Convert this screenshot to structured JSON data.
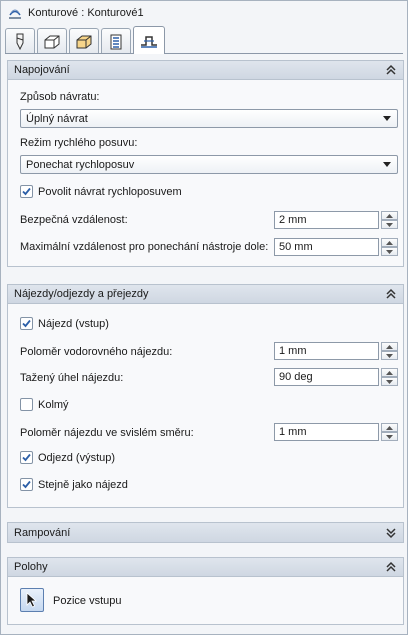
{
  "title": "Konturové : Konturové1",
  "tabs": [
    {
      "icon": "tool-icon"
    },
    {
      "icon": "cube-icon"
    },
    {
      "icon": "stock-icon"
    },
    {
      "icon": "passes-icon"
    },
    {
      "icon": "linking-icon"
    }
  ],
  "linking": {
    "header": "Napojování",
    "retract_label": "Způsob návratu:",
    "retract_value": "Úplný návrat",
    "rapid_label": "Režim rychlého posuvu:",
    "rapid_value": "Ponechat rychloposuv",
    "allow_rapid_label": "Povolit návrat rychloposuvem",
    "allow_rapid_checked": true,
    "safe_distance_label": "Bezpečná vzdálenost:",
    "safe_distance_value": "2 mm",
    "max_stay_down_label": "Maximální vzdálenost pro ponechání nástroje dole:",
    "max_stay_down_value": "50 mm"
  },
  "leads": {
    "header": "Nájezdy/odjezdy a přejezdy",
    "lead_in_label": "Nájezd (vstup)",
    "lead_in_checked": true,
    "horiz_radius_label": "Poloměr vodorovného nájezdu:",
    "horiz_radius_value": "1 mm",
    "sweep_angle_label": "Tažený úhel nájezdu:",
    "sweep_angle_value": "90 deg",
    "perpendicular_label": "Kolmý",
    "perpendicular_checked": false,
    "vert_radius_label": "Poloměr nájezdu ve svislém směru:",
    "vert_radius_value": "1 mm",
    "lead_out_label": "Odjezd (výstup)",
    "lead_out_checked": true,
    "same_as_label": "Stejně jako nájezd",
    "same_as_checked": true
  },
  "ramping": {
    "header": "Rampování"
  },
  "positions": {
    "header": "Polohy",
    "entry_label": "Pozice vstupu"
  },
  "colors": {
    "header_bg": "#d5dce6",
    "panel_bg": "#f8f9fb",
    "border": "#b8c2ce",
    "check": "#2c5fa8"
  }
}
